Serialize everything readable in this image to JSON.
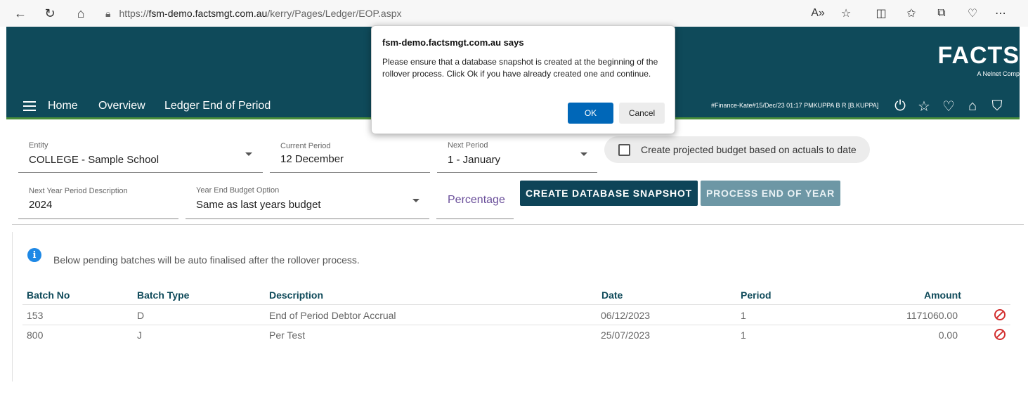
{
  "browser": {
    "url_prefix": "https://",
    "url_host": "fsm-demo.factsmgt.com.au",
    "url_path": "/kerry/Pages/Ledger/EOP.aspx"
  },
  "header": {
    "menu": [
      "Home",
      "Overview",
      "Ledger End of Period"
    ],
    "logo": "FACTS",
    "logo_sub": "A Nelnet Comp",
    "user_info": "#Finance-Kate#15/Dec/23 01:17 PMKUPPA B R [B.KUPPA]"
  },
  "form": {
    "entity": {
      "label": "Entity",
      "value": "COLLEGE - Sample School"
    },
    "current_period": {
      "label": "Current Period",
      "value": "12 December"
    },
    "next_period": {
      "label": "Next Period",
      "value": "1 - January"
    },
    "projected_budget_label": "Create projected budget based on actuals to date",
    "next_year_desc": {
      "label": "Next Year Period Description",
      "value": "2024"
    },
    "budget_option": {
      "label": "Year End Budget Option",
      "value": "Same as last years budget"
    },
    "percentage_placeholder": "Percentage",
    "snapshot_button": "CREATE DATABASE SNAPSHOT",
    "process_button": "PROCESS END OF YEAR"
  },
  "batches": {
    "info": "Below pending batches will be auto finalised after the rollover process.",
    "columns": [
      "Batch No",
      "Batch Type",
      "Description",
      "Date",
      "Period",
      "Amount"
    ],
    "rows": [
      {
        "batch_no": "153",
        "type": "D",
        "description": "End of Period Debtor Accrual",
        "date": "06/12/2023",
        "period": "1",
        "amount": "1171060.00"
      },
      {
        "batch_no": "800",
        "type": "J",
        "description": "Per Test",
        "date": "25/07/2023",
        "period": "1",
        "amount": "0.00"
      }
    ]
  },
  "dialog": {
    "title": "fsm-demo.factsmgt.com.au says",
    "message": "Please ensure that a database snapshot is created at the beginning of the rollover process. Click Ok if you have already created one and continue.",
    "ok": "OK",
    "cancel": "Cancel"
  },
  "colors": {
    "header_bg": "#0f4a5a",
    "primary_button": "#0e4458",
    "disabled_button": "#6d97a5",
    "dialog_ok": "#0067b8",
    "cancel_red": "#d32f2f"
  }
}
